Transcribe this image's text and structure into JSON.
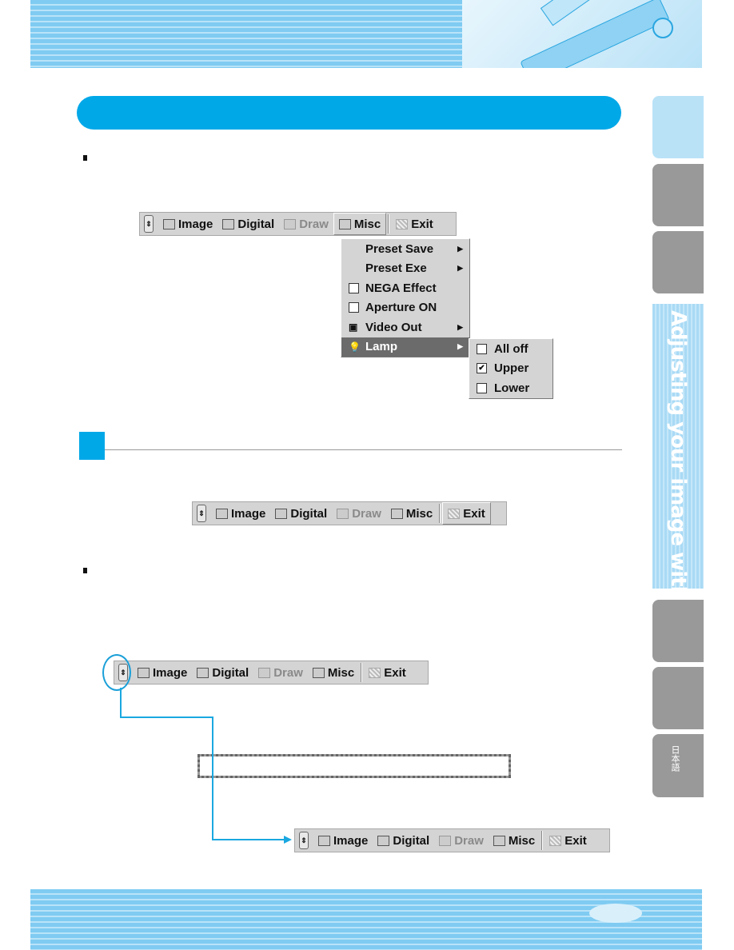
{
  "toolbar": {
    "items": [
      {
        "label": "Image",
        "icon": "image-icon",
        "state": "normal"
      },
      {
        "label": "Digital",
        "icon": "digital-icon",
        "state": "normal"
      },
      {
        "label": "Draw",
        "icon": "draw-icon",
        "state": "disabled"
      },
      {
        "label": "Misc",
        "icon": "misc-icon",
        "state": "normal"
      },
      {
        "label": "Exit",
        "icon": "exit-icon",
        "state": "normal"
      }
    ]
  },
  "toolbars_active": [
    "Misc",
    "Exit",
    "",
    ""
  ],
  "misc_menu": {
    "items": [
      {
        "label": "Preset Save",
        "type": "submenu"
      },
      {
        "label": "Preset Exe",
        "type": "submenu"
      },
      {
        "label": "NEGA Effect",
        "type": "checkbox",
        "checked": false
      },
      {
        "label": "Aperture ON",
        "type": "checkbox",
        "checked": false
      },
      {
        "label": "Video Out",
        "type": "submenu",
        "icon": "video-out-icon"
      },
      {
        "label": "Lamp",
        "type": "submenu",
        "icon": "lamp-icon",
        "highlighted": true
      }
    ]
  },
  "lamp_submenu": {
    "items": [
      {
        "label": "All off",
        "checked": false
      },
      {
        "label": "Upper",
        "checked": true
      },
      {
        "label": "Lower",
        "checked": false
      }
    ]
  },
  "side_tabs": {
    "active_label": "Adjusting your image with GUI",
    "lang_label": "日本語"
  },
  "colors": {
    "accent": "#00a8e8",
    "menu_highlight": "#6b6b6b",
    "toolbar_bg": "#d4d4d4"
  }
}
